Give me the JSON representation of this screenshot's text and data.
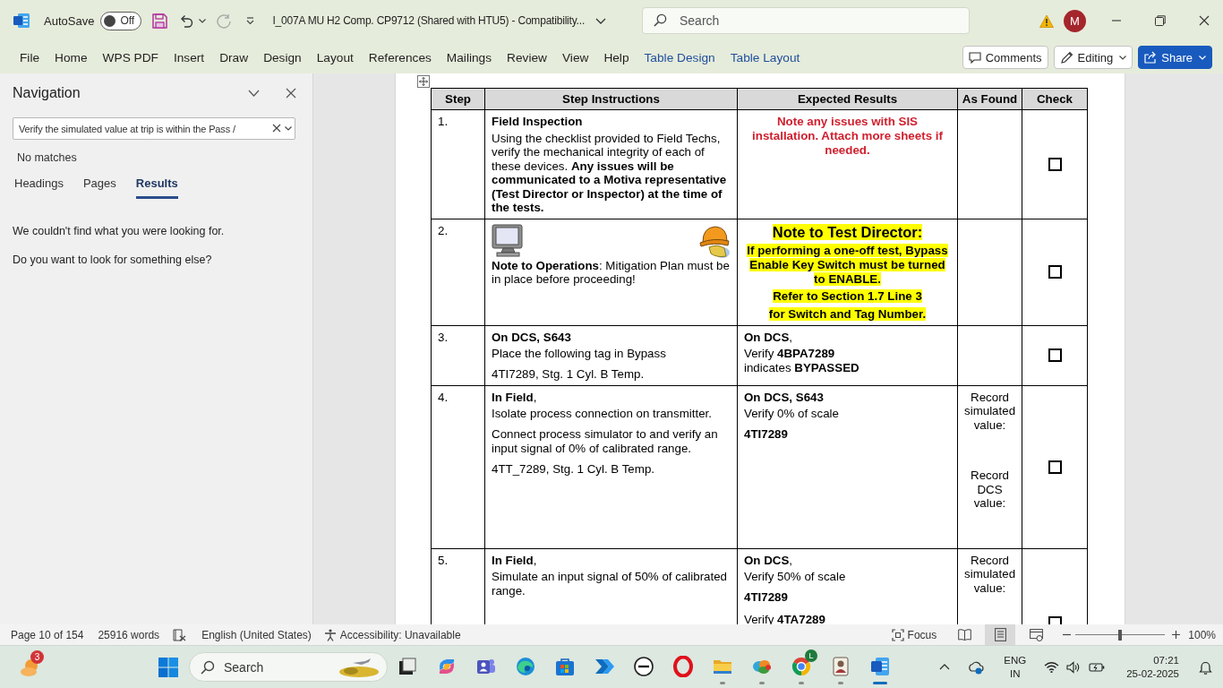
{
  "title_bar": {
    "autosave": {
      "label": "AutoSave",
      "on": false,
      "state_text": "Off"
    },
    "redo_disabled": true,
    "title": "I_007A MU H2 Comp. CP9712 (Shared with HTU5) - Compatibility...",
    "search": {
      "placeholder": "Search"
    },
    "account_initial": "M"
  },
  "ribbon": {
    "tabs": [
      {
        "label": "File",
        "contextual": false
      },
      {
        "label": "Home",
        "contextual": false
      },
      {
        "label": "WPS PDF",
        "contextual": false
      },
      {
        "label": "Insert",
        "contextual": false
      },
      {
        "label": "Draw",
        "contextual": false
      },
      {
        "label": "Design",
        "contextual": false
      },
      {
        "label": "Layout",
        "contextual": false
      },
      {
        "label": "References",
        "contextual": false
      },
      {
        "label": "Mailings",
        "contextual": false
      },
      {
        "label": "Review",
        "contextual": false
      },
      {
        "label": "View",
        "contextual": false
      },
      {
        "label": "Help",
        "contextual": false
      },
      {
        "label": "Table Design",
        "contextual": true
      },
      {
        "label": "Table Layout",
        "contextual": true
      }
    ],
    "comments": "Comments",
    "editing": "Editing",
    "share": "Share"
  },
  "navigation": {
    "title": "Navigation",
    "search_value": "Verify the simulated value at trip is within the Pass /",
    "match_status": "No matches",
    "tabs": [
      {
        "label": "Headings",
        "selected": false
      },
      {
        "label": "Pages",
        "selected": false
      },
      {
        "label": "Results",
        "selected": true
      }
    ],
    "messages": [
      "We couldn't find what you were looking for.",
      "Do you want to look for something else?"
    ]
  },
  "document": {
    "table": {
      "columns": [
        "Step",
        "Step Instructions",
        "Expected Results",
        "As Found",
        "Check"
      ],
      "rows": [
        {
          "step": "1.",
          "instructions": [
            {
              "kind": "heading",
              "text": "Field Inspection"
            },
            {
              "kind": "body",
              "text": "Using the checklist provided to Field Techs, verify the mechanical integrity of each of these devices. **Any issues will be communicated to a Motiva representative (Test Director or Inspector) at the time of the tests.**"
            }
          ],
          "expected": [
            {
              "kind": "alert",
              "text": "Note any issues with SIS installation. Attach more sheets if needed."
            }
          ],
          "checked": false
        },
        {
          "step": "2.",
          "instructions": [
            {
              "kind": "clipart"
            },
            {
              "kind": "body",
              "text": "**Note to Operations**: Mitigation Plan must be in place before proceeding!"
            }
          ],
          "expected": [
            {
              "kind": "highlight-title",
              "text": "Note to Test Director:"
            },
            {
              "kind": "highlight",
              "text": "If performing a one-off test, Bypass Enable Key Switch must be turned to ENABLE."
            },
            {
              "kind": "highlight",
              "text": "Refer to Section 1.7 Line 3"
            },
            {
              "kind": "highlight",
              "text": "for Switch and Tag Number."
            }
          ],
          "checked": false
        },
        {
          "step": "3.",
          "instructions": [
            {
              "kind": "heading",
              "text": "On DCS, S643"
            },
            {
              "kind": "body",
              "text": "Place the following tag in Bypass"
            },
            {
              "kind": "body",
              "text": "4TI7289, Stg. 1 Cyl. B Temp."
            }
          ],
          "expected": [
            {
              "kind": "lead",
              "text": "**On DCS**,"
            },
            {
              "kind": "line",
              "text": "Verify **4BPA7289**"
            },
            {
              "kind": "body",
              "text": "indicates **BYPASSED**"
            }
          ],
          "checked": false
        },
        {
          "step": "4.",
          "instructions": [
            {
              "kind": "lead",
              "text": "**In Field**,"
            },
            {
              "kind": "body",
              "text": "Isolate process connection on transmitter."
            },
            {
              "kind": "body",
              "text": "Connect process simulator to and verify an input signal of 0% of calibrated range."
            },
            {
              "kind": "body",
              "text": "4TT_7289, Stg. 1 Cyl. B Temp."
            }
          ],
          "expected": [
            {
              "kind": "heading",
              "text": "On DCS, S643"
            },
            {
              "kind": "body",
              "text": "Verify 0% of scale"
            },
            {
              "kind": "strong",
              "text": "4TI7289"
            }
          ],
          "as_found": [
            "Record simulated value:",
            "Record DCS value:"
          ],
          "checked": false
        },
        {
          "step": "5.",
          "instructions": [
            {
              "kind": "lead",
              "text": "**In Field**,"
            },
            {
              "kind": "body",
              "text": "Simulate an input signal of 50% of calibrated range."
            }
          ],
          "expected": [
            {
              "kind": "lead",
              "text": "**On DCS**,"
            },
            {
              "kind": "body",
              "text": "Verify 50% of scale"
            },
            {
              "kind": "strong",
              "text": "4TI7289"
            },
            {
              "kind": "body",
              "text": "Verify **4TA7289**"
            }
          ],
          "as_found": [
            "Record simulated value:"
          ],
          "checked": false
        }
      ]
    }
  },
  "status_bar": {
    "page": "Page 10 of 154",
    "words": "25916 words",
    "language": "English (United States)",
    "accessibility": "Accessibility: Unavailable",
    "focus": "Focus",
    "views": [
      {
        "kind": "read",
        "selected": false
      },
      {
        "kind": "print",
        "selected": true
      },
      {
        "kind": "web",
        "selected": false
      }
    ],
    "zoom": {
      "level": 0.5,
      "reading": "100%"
    }
  },
  "taskbar": {
    "weather_badge": "3",
    "search_label": "Search",
    "apps": [
      {
        "kind": "stack",
        "running": false,
        "active": false
      },
      {
        "kind": "swirl",
        "running": false,
        "active": false
      },
      {
        "kind": "people",
        "running": false,
        "active": false
      },
      {
        "kind": "wave",
        "running": false,
        "active": false
      },
      {
        "kind": "bag",
        "running": false,
        "active": false
      },
      {
        "kind": "chevrons",
        "running": false,
        "active": false
      },
      {
        "kind": "ring-logo",
        "running": false,
        "active": false
      },
      {
        "kind": "oval-ring",
        "running": false,
        "active": false
      },
      {
        "kind": "folder",
        "running": true,
        "active": false
      },
      {
        "kind": "blob",
        "running": true,
        "active": false
      },
      {
        "kind": "tricolor",
        "badge": "L",
        "running": true,
        "active": false
      },
      {
        "kind": "id-card",
        "running": true,
        "active": false
      },
      {
        "kind": "document",
        "running": true,
        "active": true
      }
    ],
    "input_language": [
      "ENG",
      "IN"
    ],
    "time": "07:21",
    "date": "25-02-2025"
  }
}
